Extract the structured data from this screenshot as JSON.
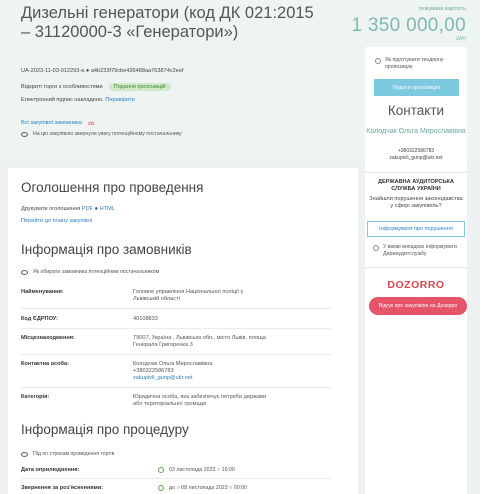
{
  "header": {
    "title": "Дизельні генератори (код ДК 021:2015 – 31120000-3 «Генератори»)",
    "tender_id": "UA-2023-11-03-012293-a ● a4b233f79cbe436488aa763874c2eef",
    "procurement_type": "Відкриті торги з особливостями",
    "status": "Подання пропозицій",
    "esign_text": "Електронний підпис накладено.",
    "esign_link": "Перевірити",
    "all_purchases": "Всі закупівлі замовника",
    "watch_note": "На цю закупівлю звернули увагу потенційному постачальнику",
    "price_label": "очікувана вартість",
    "price": "1 350 000,00",
    "currency": "UAH"
  },
  "sidebar": {
    "subscribe_note": "Як підготувати тендерну пропозицію",
    "questions_button": "Подати пропозицію",
    "contacts_title": "Контакти",
    "contact_name": "Колодчак Ольга Мирославівна",
    "contact_phone": "+380322586783",
    "contact_email": "zakupivli_gunp@ukr.net",
    "audit_title": "ДЕРЖАВНА АУДИТОРСЬКА СЛУЖБА УКРАЇНИ",
    "audit_text": "Знайшли порушення законодавства у сфері закупівель?",
    "report_button": "Інформувати про порушення",
    "audit_note": "У вживі випадках інформувати Держаудитслужбу",
    "dozorro": "DOZORRO",
    "feedback_button": "Відгук про закупівлю на Дозорро"
  },
  "main": {
    "announcement_title": "Оголошення про проведення",
    "print_label": "Друкувати оголошення",
    "print_pdf": "PDF",
    "print_sep": "●",
    "print_html": "HTML",
    "plan_link": "Перейти до плану закупівлі",
    "customer_title": "Інформація про замовників",
    "customer_note": "Як обирати замовника потенційним постачальником",
    "rows": {
      "name_label": "Найменування:",
      "name_value": "Головне управління Національної поліції у Львівській області",
      "edrpou_label": "Код ЄДРПОУ:",
      "edrpou_value": "40108833",
      "location_label": "Місцезнаходження:",
      "location_value": "79007, Україна , Львівська обл., місто Львів, площа Генерала Григоренка 3",
      "contact_label": "Контактна особа:",
      "contact_value": "Колодчак Ольга Мирославівна",
      "contact_phone": "+380322586783",
      "contact_email": "zakupivli_gunp@ukr.net",
      "category_label": "Категорія:",
      "category_value": "Юридична особа, яка забезпечує потреби держави або територіальної громади"
    },
    "procedure_title": "Інформація про процедуру",
    "procedure_note": "Під по строкам проведення торгів",
    "dates": {
      "published_label": "Дата оприлюднення:",
      "published_value": "03 листопада 2023 ○ 16:00",
      "clarify_label": "Звернення за роз'ясненнями:",
      "clarify_value": "до ○ 08 листопада 2023 ○ 00:00"
    }
  }
}
